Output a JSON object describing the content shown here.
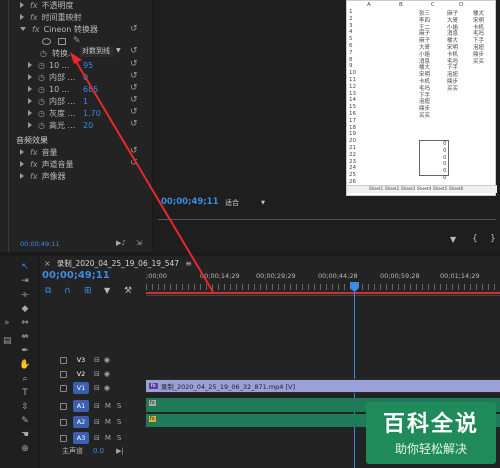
{
  "effect_controls": {
    "items": [
      {
        "label": "不透明度",
        "fx": true,
        "expanded": false
      },
      {
        "label": "时间重映射",
        "fx": true,
        "expanded": false
      },
      {
        "label": "Cineon 转换器",
        "fx": true,
        "expanded": true
      }
    ],
    "convert_label": "转换...",
    "convert_value": "对数到线",
    "params": [
      {
        "label": "10 ...",
        "value": "95"
      },
      {
        "label": "内部 ...",
        "value": "0"
      },
      {
        "label": "10 ...",
        "value": "685"
      },
      {
        "label": "内部 ...",
        "value": "1"
      },
      {
        "label": "灰度 ...",
        "value": "1.70"
      },
      {
        "label": "高光 ...",
        "value": "20"
      }
    ],
    "audio_section": "音频效果",
    "audio_items": [
      "音量",
      "声道音量",
      "声像器"
    ],
    "timecode": "00;00;49;11"
  },
  "program_monitor": {
    "timecode": "00;00;49;11",
    "fit_label": "适合"
  },
  "spreadsheet": {
    "columns": [
      "A",
      "B",
      "C",
      "D"
    ],
    "col_b": [
      "张三",
      "李四",
      "王二",
      "麻子",
      "麻子",
      "大哥",
      "小姐",
      "消息",
      "楼大",
      "宋明",
      "卡机",
      "毛吗",
      "下手",
      "泡妞",
      "鼎步",
      "买买"
    ],
    "col_c": [
      "麻子",
      "大哥",
      "小姐",
      "消息",
      "楼大",
      "宋明",
      "卡机",
      "毛吗",
      "下手",
      "泡妞",
      "鼎步",
      "买买"
    ],
    "col_d": [
      "楼大",
      "宋明",
      "卡机",
      "毛吗",
      "下手",
      "泡妞",
      "鼎步",
      "买买"
    ],
    "row_numbers": [
      "1",
      "2",
      "3",
      "4",
      "5",
      "6",
      "7",
      "8",
      "9",
      "10",
      "11",
      "12",
      "13",
      "14",
      "15",
      "16",
      "17",
      "18",
      "19",
      "20",
      "21",
      "22",
      "23",
      "24",
      "25",
      "26"
    ],
    "zeros": [
      "0",
      "0",
      "0",
      "0",
      "0",
      "0"
    ],
    "tabs": [
      "Sheet1",
      "Sheet2",
      "Sheet3",
      "Sheet4",
      "Sheet5",
      "Sheet6"
    ]
  },
  "timeline": {
    "sequence_name": "录制_2020_04_25_19_06_19_547",
    "timecode": "00;00;49;11",
    "ruler": [
      ";00;00",
      "00;00;14;29",
      "00;00;29;29",
      "00;00;44;28",
      "00;00;59;28",
      "00;01;14;29"
    ],
    "video_tracks": [
      "V3",
      "V2",
      "V1"
    ],
    "audio_tracks": [
      "A1",
      "A2",
      "A3"
    ],
    "master_label": "主声道",
    "master_value": "0.0",
    "clip_label": "录制_2020_04_25_19_06_32_871.mp4 [V]",
    "clip_badge": "fx",
    "colors": {
      "accent_blue": "#3c8ce6",
      "clip_video": "#9aa0d8",
      "clip_audio": "#1f7a5a",
      "arrow_red": "#e8282b"
    }
  },
  "watermark": {
    "title": "百科全说",
    "subtitle": "助你轻松解决"
  }
}
